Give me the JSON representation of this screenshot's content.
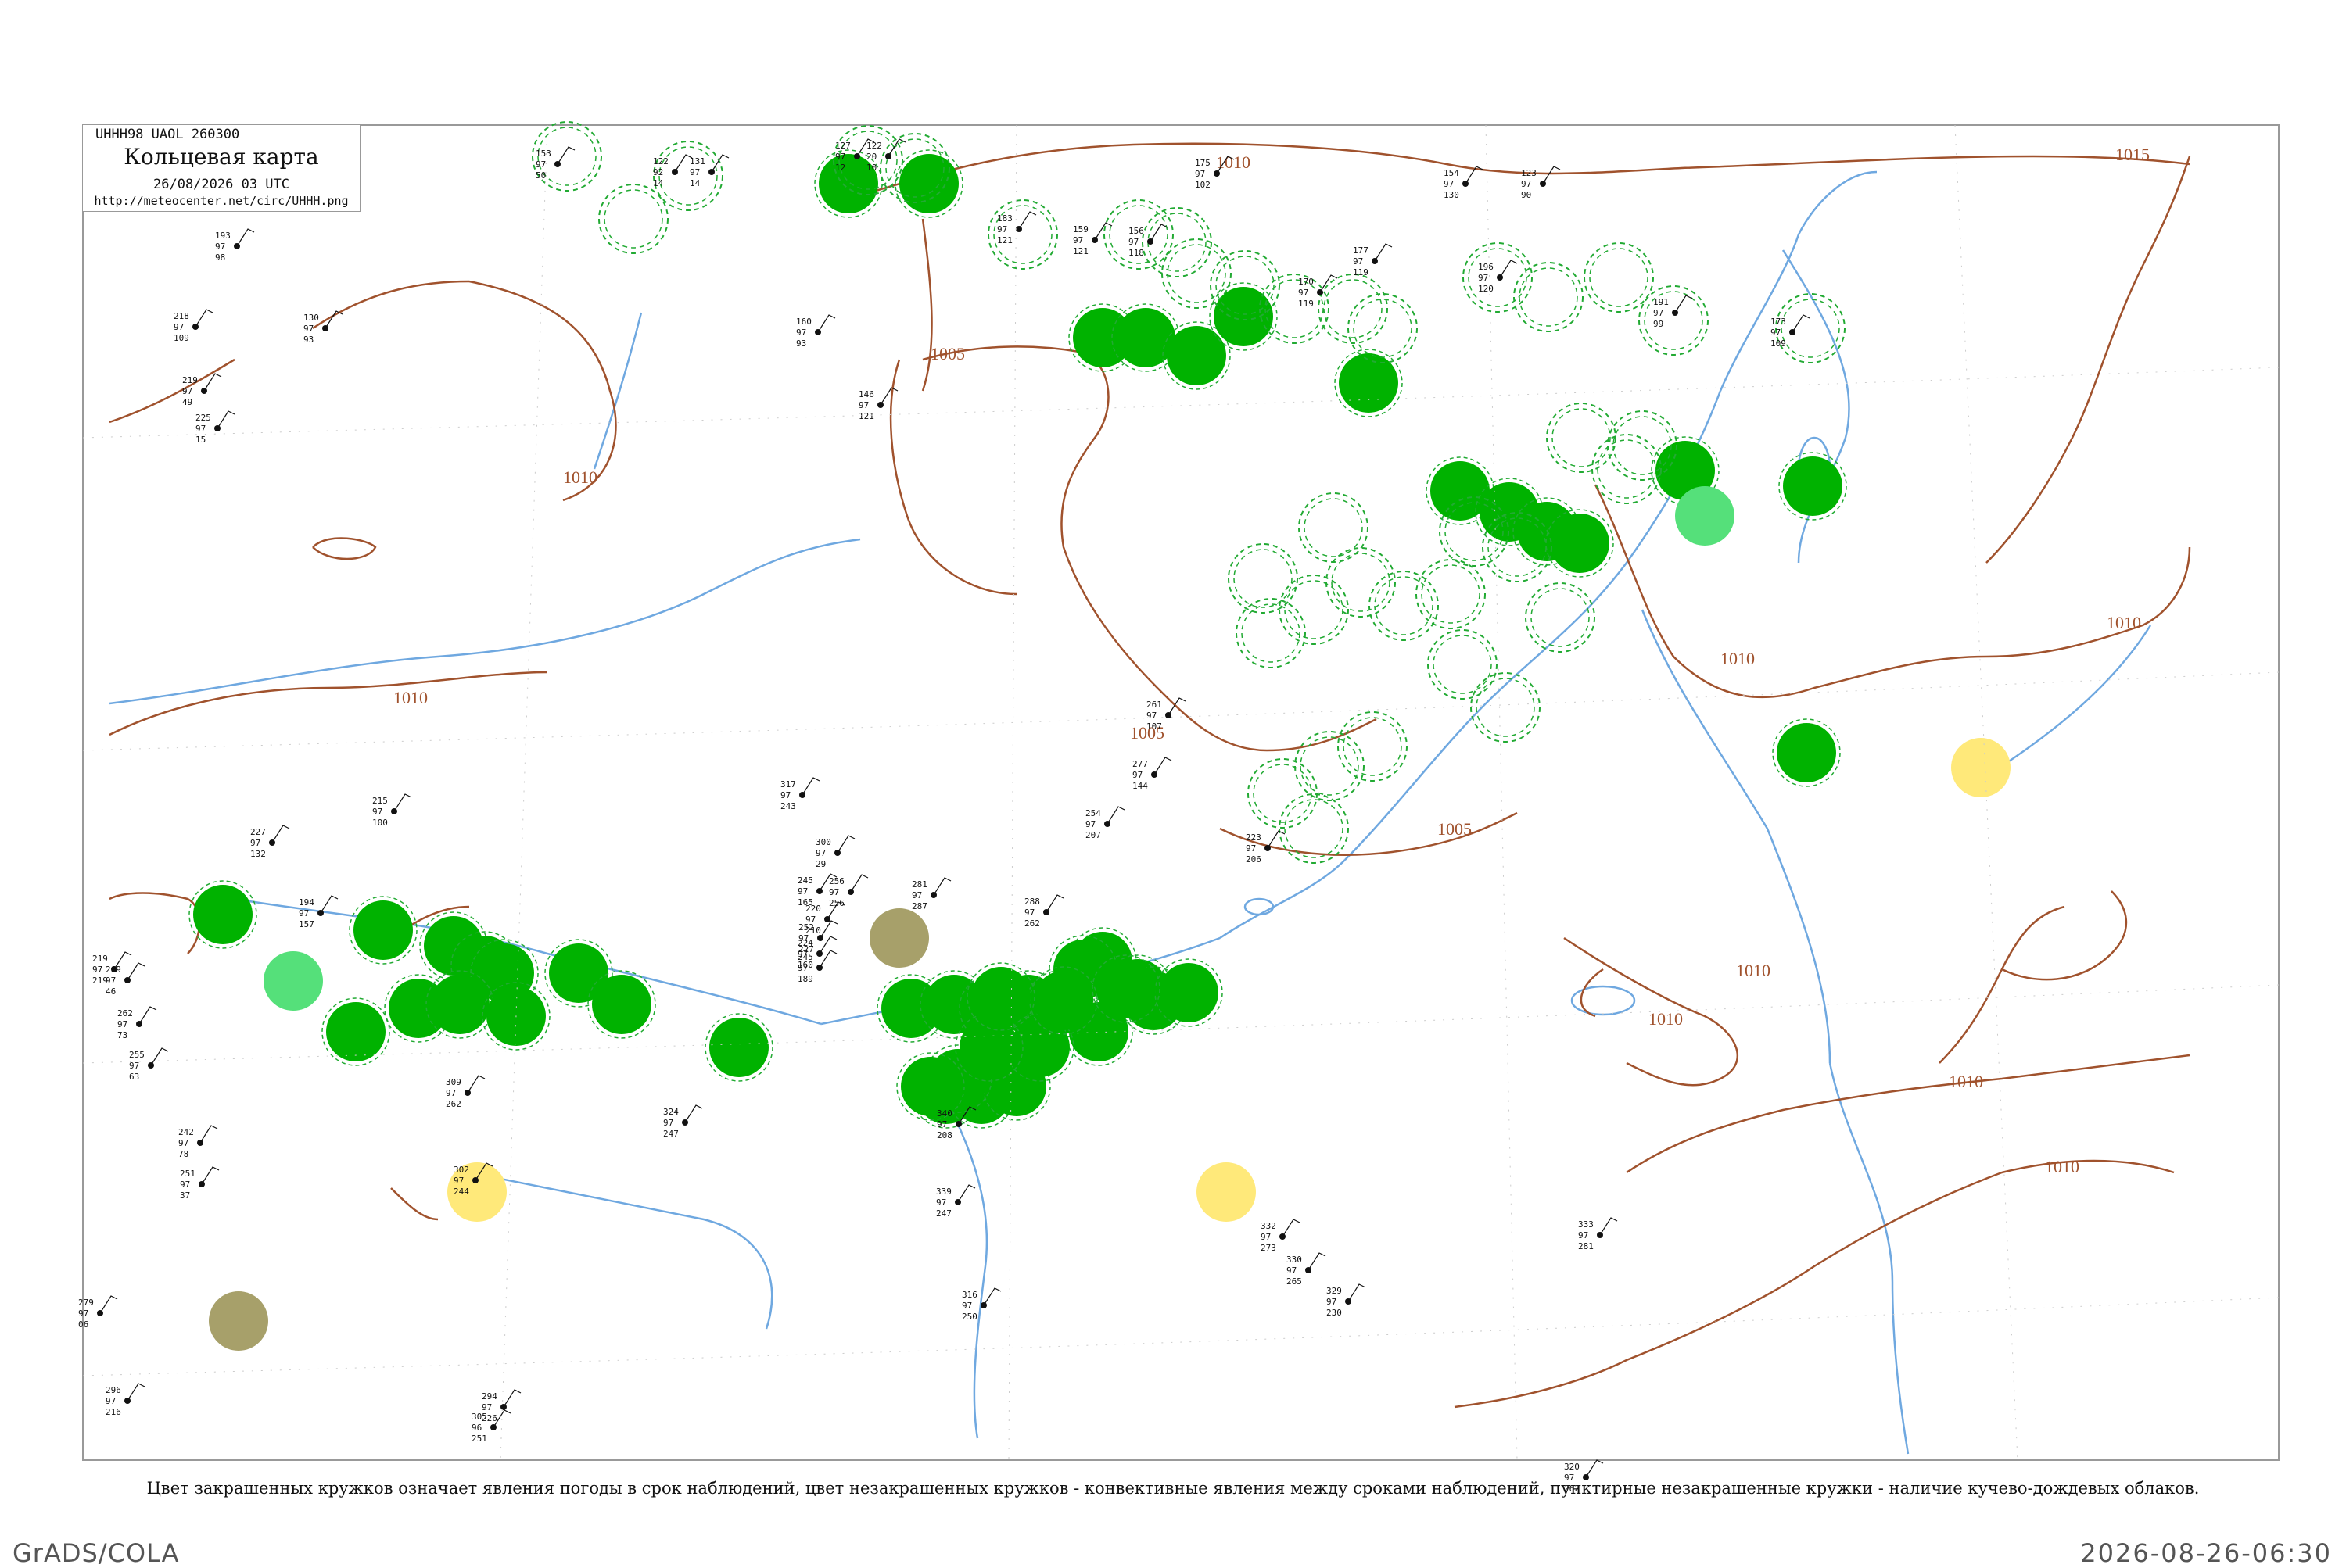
{
  "header": {
    "code": "UHHH98  UAOL  260300",
    "title": "Кольцевая карта",
    "date": "26/08/2026 03 UTC",
    "url": "http://meteocenter.net/circ/UHHH.png"
  },
  "caption": "Цвет закрашенных кружков означает явления погоды в срок наблюдений, цвет незакрашенных кружков - конвективные явления между сроками наблюдений, пунктирные незакрашенные кружки - наличие кучево-дождевых облаков.",
  "footer": {
    "left": "GrADS/COLA",
    "right": "2026-08-26-06:30"
  },
  "colors": {
    "isobar": "#a0522d",
    "river": "#6fa8e0",
    "fill_green": "#00b200",
    "fill_light_green": "#55e07a",
    "fill_yellow": "#ffe97a",
    "fill_olive": "#a7a06a",
    "dashed_ring": "#22aa33",
    "frame": "#999999"
  },
  "isobars": [
    {
      "label": "1015"
    },
    {
      "label": "1010"
    },
    {
      "label": "1010"
    },
    {
      "label": "1005"
    },
    {
      "label": "1005"
    },
    {
      "label": "1005"
    },
    {
      "label": "1010"
    },
    {
      "label": "1010"
    },
    {
      "label": "1010"
    },
    {
      "label": "1010"
    },
    {
      "label": "1010"
    },
    {
      "label": "1010"
    },
    {
      "label": "1010"
    }
  ],
  "station_circles": [
    {
      "type": "fill_green"
    },
    {
      "type": "fill_green"
    },
    {
      "type": "fill_green"
    },
    {
      "type": "fill_green"
    },
    {
      "type": "fill_green"
    },
    {
      "type": "fill_green"
    },
    {
      "type": "fill_green"
    },
    {
      "type": "fill_green"
    },
    {
      "type": "fill_green"
    },
    {
      "type": "fill_green"
    },
    {
      "type": "fill_green"
    },
    {
      "type": "fill_green"
    },
    {
      "type": "fill_green"
    },
    {
      "type": "fill_green"
    },
    {
      "type": "fill_green"
    },
    {
      "type": "fill_green"
    },
    {
      "type": "fill_green"
    },
    {
      "type": "fill_green"
    },
    {
      "type": "fill_green"
    },
    {
      "type": "fill_green"
    },
    {
      "type": "fill_green"
    },
    {
      "type": "fill_green"
    },
    {
      "type": "fill_green"
    },
    {
      "type": "fill_green"
    },
    {
      "type": "fill_green"
    },
    {
      "type": "fill_green"
    },
    {
      "type": "fill_green"
    },
    {
      "type": "fill_green"
    },
    {
      "type": "fill_green"
    },
    {
      "type": "fill_green"
    },
    {
      "type": "fill_green"
    },
    {
      "type": "fill_green"
    },
    {
      "type": "fill_green"
    },
    {
      "type": "fill_green"
    },
    {
      "type": "fill_green"
    },
    {
      "type": "fill_green"
    },
    {
      "type": "fill_green"
    },
    {
      "type": "fill_green"
    },
    {
      "type": "fill_green"
    },
    {
      "type": "fill_green"
    },
    {
      "type": "fill_green"
    },
    {
      "type": "fill_green"
    },
    {
      "type": "fill_green"
    },
    {
      "type": "fill_green"
    },
    {
      "type": "fill_green"
    },
    {
      "type": "fill_green"
    },
    {
      "type": "fill_green"
    },
    {
      "type": "fill_light_green"
    },
    {
      "type": "fill_light_green"
    },
    {
      "type": "fill_yellow"
    },
    {
      "type": "fill_yellow"
    },
    {
      "type": "fill_yellow"
    },
    {
      "type": "fill_olive"
    },
    {
      "type": "fill_olive"
    },
    {
      "type": "dashed_ring"
    },
    {
      "type": "dashed_ring"
    },
    {
      "type": "dashed_ring"
    },
    {
      "type": "dashed_ring"
    },
    {
      "type": "dashed_ring"
    },
    {
      "type": "dashed_ring"
    },
    {
      "type": "dashed_ring"
    },
    {
      "type": "dashed_ring"
    },
    {
      "type": "dashed_ring"
    },
    {
      "type": "dashed_ring"
    },
    {
      "type": "dashed_ring"
    },
    {
      "type": "dashed_ring"
    },
    {
      "type": "dashed_ring"
    },
    {
      "type": "dashed_ring"
    },
    {
      "type": "dashed_ring"
    },
    {
      "type": "dashed_ring"
    },
    {
      "type": "dashed_ring"
    },
    {
      "type": "dashed_ring"
    },
    {
      "type": "dashed_ring"
    },
    {
      "type": "dashed_ring"
    },
    {
      "type": "dashed_ring"
    },
    {
      "type": "dashed_ring"
    },
    {
      "type": "dashed_ring"
    },
    {
      "type": "dashed_ring"
    },
    {
      "type": "dashed_ring"
    },
    {
      "type": "dashed_ring"
    },
    {
      "type": "dashed_ring"
    },
    {
      "type": "dashed_ring"
    },
    {
      "type": "dashed_ring"
    },
    {
      "type": "dashed_ring"
    },
    {
      "type": "dashed_ring"
    },
    {
      "type": "dashed_ring"
    },
    {
      "type": "dashed_ring"
    },
    {
      "type": "dashed_ring"
    },
    {
      "type": "dashed_ring"
    },
    {
      "type": "dashed_ring"
    },
    {
      "type": "dashed_ring"
    }
  ],
  "stations": [
    {
      "p": "153",
      "t": "97",
      "d": "50"
    },
    {
      "p": "122",
      "t": "92",
      "d": "14"
    },
    {
      "p": "131",
      "t": "97",
      "d": "14"
    },
    {
      "p": "127",
      "t": "97",
      "d": "12"
    },
    {
      "p": "122",
      "t": "20",
      "d": "10"
    },
    {
      "p": "175",
      "t": "97",
      "d": "102"
    },
    {
      "p": "154",
      "t": "97",
      "d": "130"
    },
    {
      "p": "123",
      "t": "97",
      "d": "90"
    },
    {
      "p": "193",
      "t": "97",
      "d": "98"
    },
    {
      "p": "218",
      "t": "97",
      "d": "109"
    },
    {
      "p": "225",
      "t": "97",
      "d": "15"
    },
    {
      "p": "219",
      "t": "97",
      "d": "49"
    },
    {
      "p": "130",
      "t": "97",
      "d": "93"
    },
    {
      "p": "183",
      "t": "97",
      "d": "121"
    },
    {
      "p": "159",
      "t": "97",
      "d": "121"
    },
    {
      "p": "156",
      "t": "97",
      "d": "118"
    },
    {
      "p": "177",
      "t": "97",
      "d": "119"
    },
    {
      "p": "170",
      "t": "97",
      "d": "119"
    },
    {
      "p": "196",
      "t": "97",
      "d": "120"
    },
    {
      "p": "173",
      "t": "97",
      "d": "109"
    },
    {
      "p": "191",
      "t": "97",
      "d": "99"
    },
    {
      "p": "160",
      "t": "97",
      "d": "93"
    },
    {
      "p": "146",
      "t": "97",
      "d": "121"
    },
    {
      "p": "215",
      "t": "97",
      "d": "100"
    },
    {
      "p": "227",
      "t": "97",
      "d": "132"
    },
    {
      "p": "194",
      "t": "97",
      "d": "157"
    },
    {
      "p": "219",
      "t": "97",
      "d": "219"
    },
    {
      "p": "269",
      "t": "97",
      "d": "46"
    },
    {
      "p": "262",
      "t": "97",
      "d": "73"
    },
    {
      "p": "255",
      "t": "97",
      "d": "63"
    },
    {
      "p": "242",
      "t": "97",
      "d": "78"
    },
    {
      "p": "251",
      "t": "97",
      "d": "37"
    },
    {
      "p": "279",
      "t": "97",
      "d": "06"
    },
    {
      "p": "296",
      "t": "97",
      "d": "216"
    },
    {
      "p": "294",
      "t": "97",
      "d": "226"
    },
    {
      "p": "305",
      "t": "96",
      "d": "251"
    },
    {
      "p": "316",
      "t": "97",
      "d": "250"
    },
    {
      "p": "330",
      "t": "97",
      "d": "265"
    },
    {
      "p": "329",
      "t": "97",
      "d": "230"
    },
    {
      "p": "332",
      "t": "97",
      "d": "273"
    },
    {
      "p": "320",
      "t": "97",
      "d": "262"
    },
    {
      "p": "324",
      "t": "97",
      "d": "247"
    },
    {
      "p": "340",
      "t": "97",
      "d": "208"
    },
    {
      "p": "339",
      "t": "97",
      "d": "247"
    },
    {
      "p": "317",
      "t": "97",
      "d": "243"
    },
    {
      "p": "300",
      "t": "97",
      "d": "29"
    },
    {
      "p": "256",
      "t": "97",
      "d": "256"
    },
    {
      "p": "281",
      "t": "97",
      "d": "287"
    },
    {
      "p": "288",
      "t": "97",
      "d": "262"
    },
    {
      "p": "261",
      "t": "97",
      "d": "107"
    },
    {
      "p": "277",
      "t": "97",
      "d": "144"
    },
    {
      "p": "254",
      "t": "97",
      "d": "207"
    },
    {
      "p": "223",
      "t": "97",
      "d": "206"
    },
    {
      "p": "245",
      "t": "97",
      "d": "165"
    },
    {
      "p": "220",
      "t": "97",
      "d": "210"
    },
    {
      "p": "224",
      "t": "97",
      "d": "160"
    },
    {
      "p": "245",
      "t": "97",
      "d": "189"
    },
    {
      "p": "252",
      "t": "97",
      "d": "227"
    },
    {
      "p": "309",
      "t": "97",
      "d": "262"
    },
    {
      "p": "302",
      "t": "97",
      "d": "244"
    },
    {
      "p": "333",
      "t": "97",
      "d": "281"
    }
  ]
}
